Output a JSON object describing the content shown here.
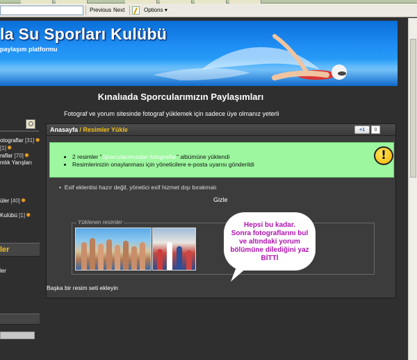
{
  "toolbar": {
    "previous_label": "Previous",
    "next_label": "Next",
    "options_label": "Options",
    "options_arrow": "▾"
  },
  "banner": {
    "title": "la Su Sporları Kulübü",
    "subtitle": "paylaşım platformu"
  },
  "page": {
    "heading": "Kınalıada Sporcularımızın Paylaşımları",
    "notice": "Fotograf ve yorum sitesinde fotograf yüklemek için sadece üye olmanız yeterli"
  },
  "sidebar": {
    "items": [
      {
        "label": "otograflar ",
        "count": "[31]",
        "star": "✹"
      },
      {
        "label": "",
        "count": "[1]",
        "star": "✹"
      },
      {
        "label": "raflar ",
        "count": "[70]",
        "star": "✹"
      },
      {
        "label": "mlık Yarışları",
        "count": "",
        "star": ""
      },
      {
        "label": "üler ",
        "count": "[40]",
        "star": "✹"
      },
      {
        "label": "Kulübü ",
        "count": "[1]",
        "star": "✹"
      }
    ],
    "section_title": "ler",
    "section_item": "ler"
  },
  "content": {
    "breadcrumb_home": "Anasayfa",
    "breadcrumb_sep": " / ",
    "breadcrumb_current": "Resimler Yükle",
    "plusone_label": "+1",
    "plusone_count": "0",
    "success": {
      "line1_prefix": "2 resimler \"",
      "line1_album": "Sporcularımızdan fotograflar",
      "line1_suffix": "\" albümüne yüklendi",
      "line2": "Resimlerinizin onaylanması için yöneticilere e-posta uyarısı gönderildi"
    },
    "warn_symbol": "!",
    "info": "Exif eklentisi hazır değil, yönetici exif hizmet dışı bırakmalı",
    "hide_link": "Gizle",
    "uploaded_legend": "Yüklenen resimler",
    "add_more": "Başka bir resim seti ekleyin"
  },
  "bubble": {
    "lines": [
      "Hepsi bu kadar.",
      "Sonra fotograflarını bul",
      "ve altındaki yorum",
      "bölümüne dilediğini yaz",
      "BİTTİ"
    ]
  },
  "colors": {
    "accent": "#f0c020",
    "success_bg": "#9cf79e",
    "bubble_text": "#b012b0"
  }
}
